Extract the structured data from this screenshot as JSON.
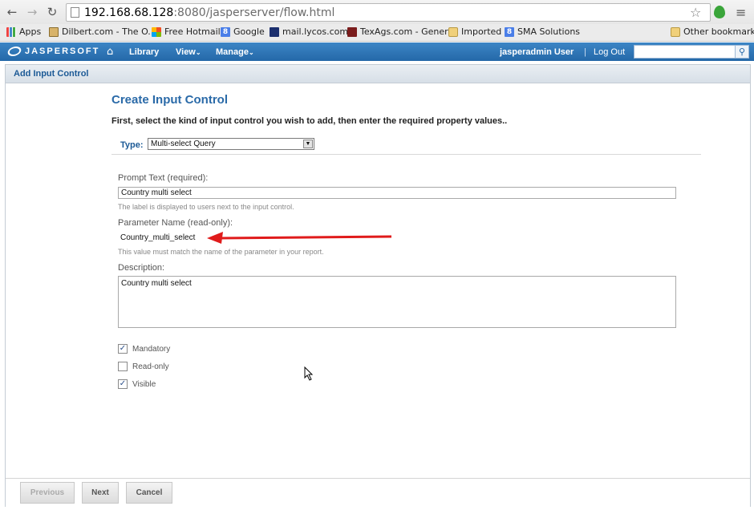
{
  "browser": {
    "url_host": "192.168.68.128",
    "url_rest": ":8080/jasperserver/flow.html",
    "bookmarks": [
      {
        "label": "Apps",
        "icon": "apps-icon"
      },
      {
        "label": "Dilbert.com - The O...",
        "icon": "dilbert-icon"
      },
      {
        "label": "Free Hotmail",
        "icon": "hotmail-icon"
      },
      {
        "label": "Google",
        "icon": "google-icon"
      },
      {
        "label": "mail.lycos.com",
        "icon": "lycos-icon"
      },
      {
        "label": "TexAgs.com - General",
        "icon": "texags-icon"
      },
      {
        "label": "Imported",
        "icon": "folder-icon"
      },
      {
        "label": "SMA Solutions",
        "icon": "google-icon"
      }
    ],
    "other_bookmarks": "Other bookmarks"
  },
  "header": {
    "logo": "JASPERSOFT",
    "nav": [
      "Library",
      "View",
      "Manage"
    ],
    "user": "jasperadmin User",
    "separator": "|",
    "logout": "Log Out",
    "search_value": ""
  },
  "title": "Add Input Control",
  "form": {
    "heading": "Create Input Control",
    "intro": "First, select the kind of input control you wish to add, then enter the required property values..",
    "type_label": "Type:",
    "type_value": "Multi-select Query",
    "prompt_label": "Prompt Text (required):",
    "prompt_value": "Country multi select",
    "prompt_hint": "The label is displayed to users next to the input control.",
    "param_label": "Parameter Name (read-only):",
    "param_value": "Country_multi_select",
    "param_hint": "This value must match the name of the parameter in your report.",
    "desc_label": "Description:",
    "desc_value": "Country multi select",
    "checkboxes": [
      {
        "label": "Mandatory",
        "checked": true
      },
      {
        "label": "Read-only",
        "checked": false
      },
      {
        "label": "Visible",
        "checked": true
      }
    ],
    "annotation_color": "#e01b1b"
  },
  "footer": {
    "previous": "Previous",
    "next": "Next",
    "cancel": "Cancel"
  }
}
